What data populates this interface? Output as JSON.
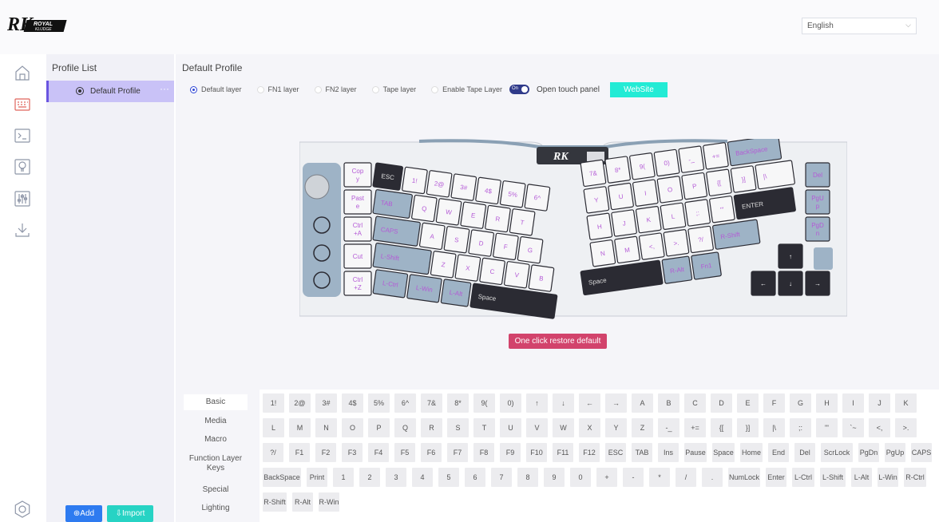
{
  "header": {
    "logo_text": "RK ROYAL KLUDGE",
    "language": "English"
  },
  "rail": {
    "icons": [
      "home-icon",
      "keyboard-icon",
      "terminal-icon",
      "lightbulb-icon",
      "sliders-icon",
      "download-icon",
      "settings-icon"
    ]
  },
  "profiles": {
    "title": "Profile List",
    "items": [
      {
        "label": "Default Profile",
        "more": "···"
      }
    ],
    "add_label": "⊕Add",
    "import_label": "⇩Import"
  },
  "main": {
    "title": "Default Profile",
    "layers": [
      "Default layer",
      "FN1 layer",
      "FN2 layer",
      "Tape layer",
      "Enable Tape Layer"
    ],
    "selected_layer": "Default layer",
    "toggle_label": "On",
    "touch_label": "Open touch panel",
    "website_label": "WebSite",
    "restore_label": "One click restore default"
  },
  "keyboard": {
    "macro_keys": [
      "Cop\ny",
      "Past\ne",
      "Ctrl\n+A",
      "Cut",
      "Ctrl\n+Z"
    ],
    "left_rows": [
      [
        "ESC",
        "1!",
        "2@",
        "3#",
        "4$",
        "5%",
        "6^"
      ],
      [
        "TAB",
        "Q",
        "W",
        "E",
        "R",
        "T"
      ],
      [
        "CAPS",
        "A",
        "S",
        "D",
        "F",
        "G"
      ],
      [
        "L-Shift",
        "Z",
        "X",
        "C",
        "V",
        "B"
      ],
      [
        "L-Ctrl",
        "L-Win",
        "L-Alt",
        "Space"
      ]
    ],
    "right_rows": [
      [
        "7&",
        "8*",
        "9(",
        "0)",
        "-_",
        "+=",
        "BackSpace",
        "Del"
      ],
      [
        "Y",
        "U",
        "I",
        "O",
        "P",
        "{[",
        "}]",
        "|\\",
        "PgU\np"
      ],
      [
        "H",
        "J",
        "K",
        "L",
        ";:",
        "\"'",
        "ENTER",
        "PgD\nn"
      ],
      [
        "N",
        "M",
        "<,",
        ">.",
        "?/",
        "R-Shift",
        "↑"
      ],
      [
        "Space",
        "R-Alt",
        "Fn1",
        "←",
        "↓",
        "→"
      ]
    ]
  },
  "categories": [
    "Basic",
    "Media",
    "Macro",
    "Function Layer Keys",
    "Special",
    "Lighting"
  ],
  "selected_category": "Basic",
  "key_rows": [
    [
      "1!",
      "2@",
      "3#",
      "4$",
      "5%",
      "6^",
      "7&",
      "8*",
      "9(",
      "0)",
      "↑",
      "↓",
      "←",
      "→",
      "A",
      "B",
      "C",
      "D",
      "E",
      "F",
      "G",
      "H",
      "I",
      "J",
      "K"
    ],
    [
      "L",
      "M",
      "N",
      "O",
      "P",
      "Q",
      "R",
      "S",
      "T",
      "U",
      "V",
      "W",
      "X",
      "Y",
      "Z",
      "-_",
      "+=",
      "{[",
      "}]",
      "|\\",
      ";:",
      "\"'",
      "`~",
      "<,",
      ">."
    ],
    [
      "?/",
      "F1",
      "F2",
      "F3",
      "F4",
      "F5",
      "F6",
      "F7",
      "F8",
      "F9",
      "F10",
      "F11",
      "F12",
      "ESC",
      "TAB",
      "Ins",
      "Pause",
      "Space",
      "Home",
      "End",
      "Del",
      "ScrLock",
      "PgDn",
      "PgUp",
      "CAPS"
    ],
    [
      "BackSpace",
      "Print",
      "1",
      "2",
      "3",
      "4",
      "5",
      "6",
      "7",
      "8",
      "9",
      "0",
      "+",
      "-",
      "*",
      "/",
      ".",
      "NumLock",
      "Enter",
      "L-Ctrl",
      "L-Shift",
      "L-Alt",
      "L-Win",
      "R-Ctrl"
    ],
    [
      "R-Shift",
      "R-Alt",
      "R-Win"
    ]
  ],
  "colors": {
    "accent": "#6a55e0",
    "teal": "#23ebd5",
    "restore": "#d2436c",
    "key_blue": "#9eb3c6",
    "key_black": "#2b2b33",
    "legend": "#b45ad6"
  }
}
